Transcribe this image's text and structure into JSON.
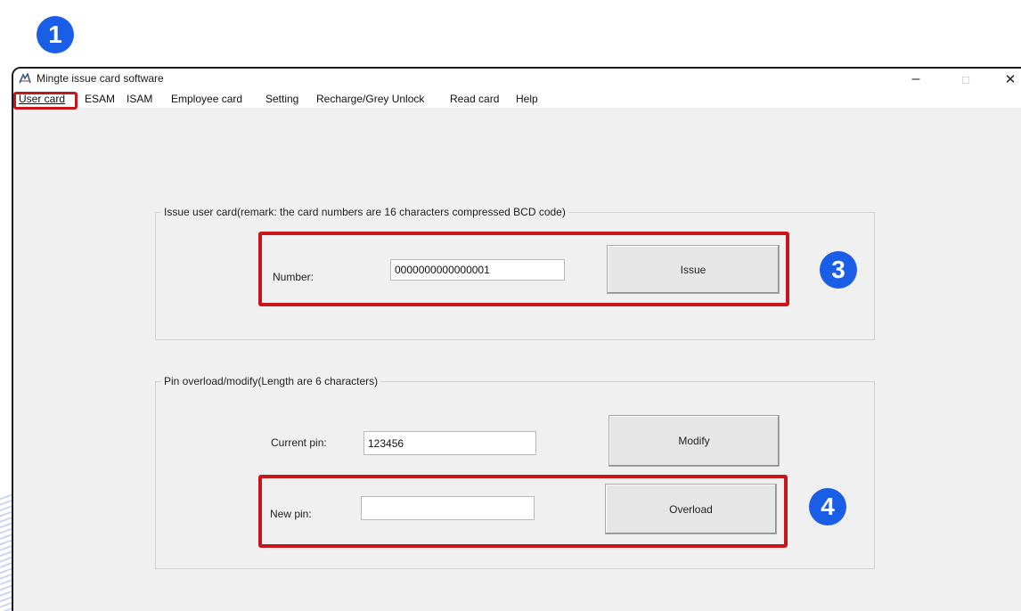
{
  "badges": {
    "step1": "1",
    "step3": "3",
    "step4": "4"
  },
  "window": {
    "title": "Mingte issue card software",
    "icon": "mingte-app-icon",
    "controls": {
      "minimize": "–",
      "maximize": "□",
      "close": "✕"
    }
  },
  "menu": {
    "items": [
      "User card",
      "ESAM",
      "ISAM",
      "Employee card",
      "Setting",
      "Recharge/Grey Unlock",
      "Read card",
      "Help"
    ]
  },
  "issue_group": {
    "legend": "Issue user card(remark: the card numbers are 16 characters compressed BCD code)",
    "number_label": "Number:",
    "number_value": "0000000000000001",
    "issue_button": "Issue"
  },
  "pin_group": {
    "legend": "Pin overload/modify(Length are 6 characters)",
    "current_label": "Current pin:",
    "current_value": "123456",
    "modify_button": "Modify",
    "new_label": "New pin:",
    "new_value": "",
    "overload_button": "Overload"
  },
  "colors": {
    "highlight": "#c8151b",
    "badge": "#1a5ee8",
    "window_bg": "#f0f0f0"
  }
}
